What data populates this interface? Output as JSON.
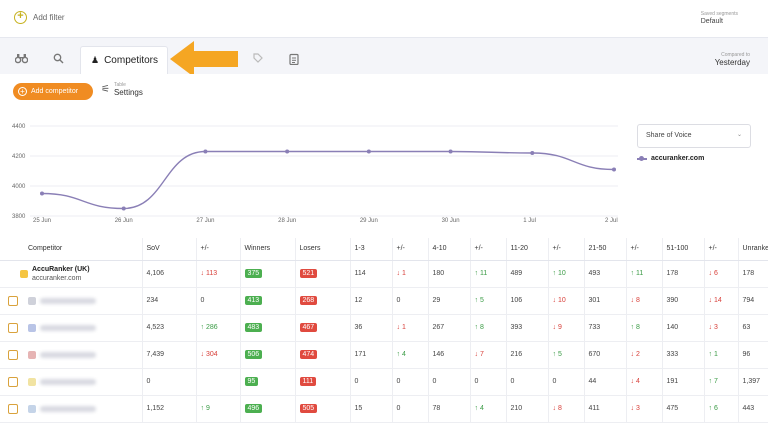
{
  "topbar": {
    "add_filter": "Add filter",
    "segments_label": "Saved segments",
    "segments_value": "Default"
  },
  "tabs": {
    "active_label": "Competitors",
    "compared_label": "Compared to",
    "compared_value": "Yesterday"
  },
  "toolbar": {
    "add_competitor": "Add competitor",
    "settings_small": "Table",
    "settings_label": "Settings"
  },
  "chart_data": {
    "type": "line",
    "x": [
      "25 Jun",
      "26 Jun",
      "27 Jun",
      "28 Jun",
      "29 Jun",
      "30 Jun",
      "1 Jul",
      "2 Jul"
    ],
    "series": [
      {
        "name": "accuranker.com",
        "values": [
          3950,
          3850,
          4230,
          4230,
          4230,
          4230,
          4220,
          4110
        ]
      }
    ],
    "ylim": [
      3800,
      4400
    ],
    "yticks": [
      "3800",
      "4000",
      "4200",
      "4400"
    ],
    "metric_select": "Share of Voice",
    "color": "#8a7fb6",
    "grid": true
  },
  "table": {
    "columns": [
      "Competitor",
      "SoV",
      "+/-",
      "Winners",
      "Losers",
      "1-3",
      "+/-",
      "4-10",
      "+/-",
      "11-20",
      "+/-",
      "21-50",
      "+/-",
      "51-100",
      "+/-",
      "Unranked"
    ],
    "rows": [
      {
        "name": "AccuRanker (UK)",
        "domain": "accuranker.com",
        "self": true,
        "fav": "#f5c542",
        "cells": [
          [
            "4,106",
            ""
          ],
          [
            "113",
            "down"
          ],
          [
            "375",
            "g"
          ],
          [
            "521",
            "r"
          ],
          [
            "114",
            ""
          ],
          [
            "1",
            "down"
          ],
          [
            "180",
            ""
          ],
          [
            "11",
            "up"
          ],
          [
            "489",
            ""
          ],
          [
            "10",
            "up"
          ],
          [
            "493",
            ""
          ],
          [
            "11",
            "up"
          ],
          [
            "178",
            ""
          ],
          [
            "6",
            "down"
          ],
          [
            "178",
            ""
          ]
        ]
      },
      {
        "fav": "#cfd1da",
        "cells": [
          [
            "234",
            ""
          ],
          [
            "0",
            ""
          ],
          [
            "413",
            "g"
          ],
          [
            "268",
            "r"
          ],
          [
            "12",
            ""
          ],
          [
            "0",
            ""
          ],
          [
            "29",
            ""
          ],
          [
            "5",
            "up"
          ],
          [
            "106",
            ""
          ],
          [
            "10",
            "down"
          ],
          [
            "301",
            ""
          ],
          [
            "8",
            "down"
          ],
          [
            "390",
            ""
          ],
          [
            "14",
            "down"
          ],
          [
            "794",
            ""
          ]
        ]
      },
      {
        "fav": "#b9c4e6",
        "cells": [
          [
            "4,523",
            ""
          ],
          [
            "286",
            "up"
          ],
          [
            "483",
            "g"
          ],
          [
            "467",
            "r"
          ],
          [
            "36",
            ""
          ],
          [
            "1",
            "down"
          ],
          [
            "267",
            ""
          ],
          [
            "8",
            "up"
          ],
          [
            "393",
            ""
          ],
          [
            "9",
            "down"
          ],
          [
            "733",
            ""
          ],
          [
            "8",
            "up"
          ],
          [
            "140",
            ""
          ],
          [
            "3",
            "down"
          ],
          [
            "63",
            ""
          ]
        ]
      },
      {
        "fav": "#e6b4b4",
        "cells": [
          [
            "7,439",
            ""
          ],
          [
            "304",
            "down"
          ],
          [
            "506",
            "g"
          ],
          [
            "474",
            "r"
          ],
          [
            "171",
            ""
          ],
          [
            "4",
            "up"
          ],
          [
            "146",
            ""
          ],
          [
            "7",
            "down"
          ],
          [
            "216",
            ""
          ],
          [
            "5",
            "up"
          ],
          [
            "670",
            ""
          ],
          [
            "2",
            "down"
          ],
          [
            "333",
            ""
          ],
          [
            "1",
            "up"
          ],
          [
            "96",
            ""
          ]
        ]
      },
      {
        "fav": "#f1e3a2",
        "cells": [
          [
            "0",
            ""
          ],
          [
            "",
            ""
          ],
          [
            "95",
            "g"
          ],
          [
            "111",
            "r"
          ],
          [
            "0",
            ""
          ],
          [
            "0",
            ""
          ],
          [
            "0",
            ""
          ],
          [
            "0",
            ""
          ],
          [
            "0",
            ""
          ],
          [
            "0",
            ""
          ],
          [
            "44",
            ""
          ],
          [
            "4",
            "down"
          ],
          [
            "191",
            ""
          ],
          [
            "7",
            "up"
          ],
          [
            "1,397",
            ""
          ]
        ]
      },
      {
        "fav": "#c5d4e8",
        "cells": [
          [
            "1,152",
            ""
          ],
          [
            "9",
            "up"
          ],
          [
            "496",
            "g"
          ],
          [
            "505",
            "r"
          ],
          [
            "15",
            ""
          ],
          [
            "0",
            ""
          ],
          [
            "78",
            ""
          ],
          [
            "4",
            "up"
          ],
          [
            "210",
            ""
          ],
          [
            "8",
            "down"
          ],
          [
            "411",
            ""
          ],
          [
            "3",
            "down"
          ],
          [
            "475",
            ""
          ],
          [
            "6",
            "up"
          ],
          [
            "443",
            ""
          ]
        ]
      }
    ]
  }
}
